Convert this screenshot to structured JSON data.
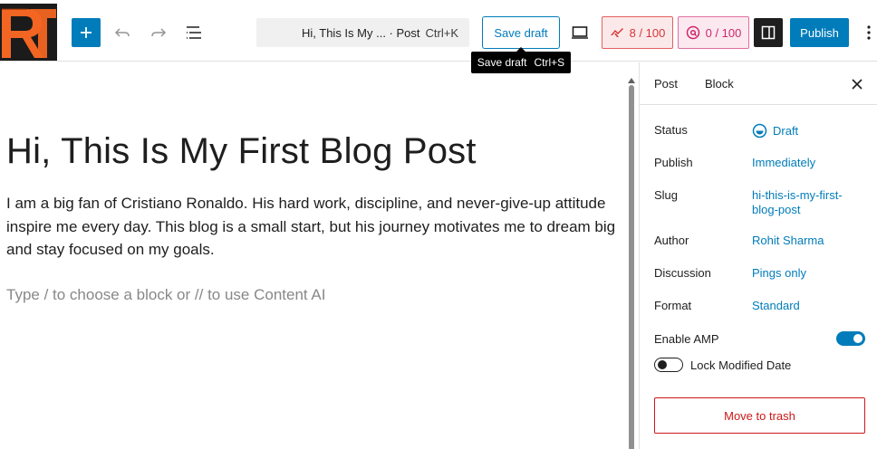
{
  "toolbar": {
    "document_title": "Hi, This Is My ... · Post",
    "command_shortcut": "Ctrl+K",
    "save_draft_label": "Save draft",
    "tooltip_label": "Save draft",
    "tooltip_shortcut": "Ctrl+S",
    "seo_score": "8 / 100",
    "ai_score": "0 / 100",
    "publish_label": "Publish",
    "icons": [
      "site-logo",
      "plus-icon",
      "undo-icon",
      "redo-icon",
      "list-view-icon",
      "desktop-preview-icon",
      "seo-score-icon",
      "content-ai-icon",
      "settings-sidebar-icon",
      "more-options-icon"
    ]
  },
  "editor": {
    "post_title": "Hi, This Is My First Blog Post",
    "paragraph": "I am a big fan of Cristiano Ronaldo. His hard work, discipline, and never-give-up attitude inspire me every day. This blog is a small start, but his journey motivates me to dream big and stay focused on my goals.",
    "block_placeholder": "Type / to choose a block or // to use Content AI"
  },
  "sidebar": {
    "tabs": [
      {
        "label": "Post",
        "active": true
      },
      {
        "label": "Block",
        "active": false
      }
    ],
    "rows": [
      {
        "label": "Status",
        "value": "Draft"
      },
      {
        "label": "Publish",
        "value": "Immediately"
      },
      {
        "label": "Slug",
        "value": "hi-this-is-my-first-blog-post"
      },
      {
        "label": "Author",
        "value": "Rohit Sharma"
      },
      {
        "label": "Discussion",
        "value": "Pings only"
      },
      {
        "label": "Format",
        "value": "Standard"
      }
    ],
    "enable_amp_label": "Enable AMP",
    "enable_amp_on": true,
    "lock_modified_label": "Lock Modified Date",
    "lock_modified_on": false,
    "trash_label": "Move to trash"
  },
  "colors": {
    "accent": "#007cba",
    "danger": "#cc1818",
    "seo_badge": "#d63638",
    "ai_badge": "#d1256b",
    "logo_orange": "#f26522"
  }
}
